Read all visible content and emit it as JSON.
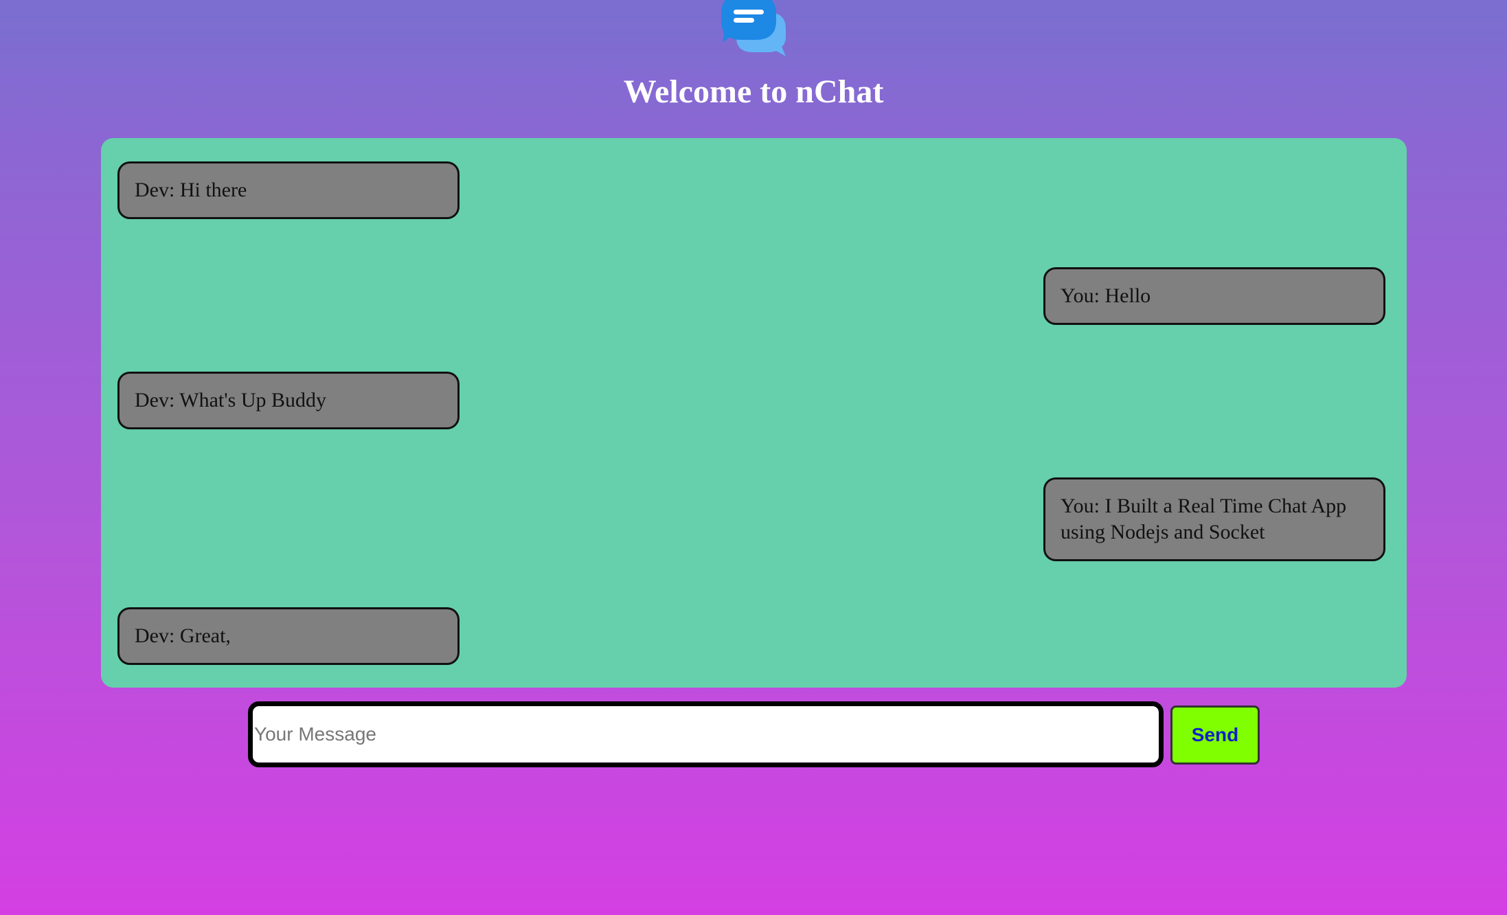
{
  "header": {
    "title": "Welcome to nChat",
    "logo_icon": "chat-bubbles-icon"
  },
  "messages": [
    {
      "sender": "Dev",
      "side": "left",
      "text": "Dev: Hi there"
    },
    {
      "sender": "You",
      "side": "right",
      "text": "You: Hello"
    },
    {
      "sender": "Dev",
      "side": "left",
      "text": "Dev: What's Up Buddy"
    },
    {
      "sender": "You",
      "side": "right",
      "text": "You: I Built a Real Time Chat App using Nodejs and Socket"
    },
    {
      "sender": "Dev",
      "side": "left",
      "text": "Dev: Great,"
    }
  ],
  "composer": {
    "placeholder": "Your Message",
    "value": "",
    "send_label": "Send"
  },
  "colors": {
    "chat_background": "#66cfab",
    "bubble_background": "#808080",
    "send_button": "#80ff00",
    "send_text": "#1020c8",
    "logo_primary": "#2196f3",
    "logo_secondary": "#64b5f6"
  }
}
